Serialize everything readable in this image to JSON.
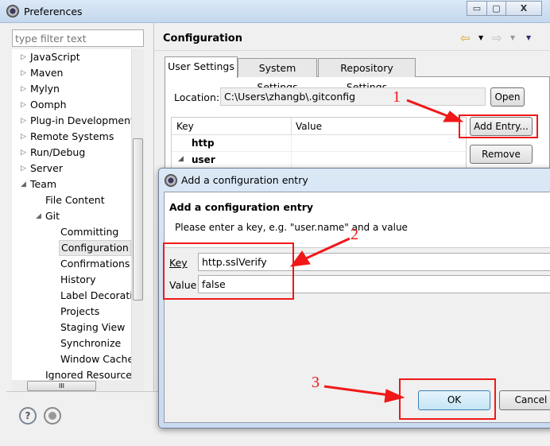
{
  "window": {
    "title": "Preferences",
    "controls": {
      "minimize": "▭",
      "maximize": "▢",
      "close": "X"
    }
  },
  "sidebar": {
    "filter_placeholder": "type filter text",
    "items": [
      {
        "label": "JavaScript",
        "level": 0,
        "state": "collapsed"
      },
      {
        "label": "Maven",
        "level": 0,
        "state": "collapsed"
      },
      {
        "label": "Mylyn",
        "level": 0,
        "state": "collapsed"
      },
      {
        "label": "Oomph",
        "level": 0,
        "state": "collapsed"
      },
      {
        "label": "Plug-in Development",
        "level": 0,
        "state": "collapsed"
      },
      {
        "label": "Remote Systems",
        "level": 0,
        "state": "collapsed"
      },
      {
        "label": "Run/Debug",
        "level": 0,
        "state": "collapsed"
      },
      {
        "label": "Server",
        "level": 0,
        "state": "collapsed"
      },
      {
        "label": "Team",
        "level": 0,
        "state": "expanded"
      },
      {
        "label": "File Content",
        "level": 1,
        "state": "leaf"
      },
      {
        "label": "Git",
        "level": 1,
        "state": "expanded"
      },
      {
        "label": "Committing",
        "level": 2,
        "state": "leaf"
      },
      {
        "label": "Configuration",
        "level": 2,
        "state": "leaf",
        "selected": true
      },
      {
        "label": "Confirmations a",
        "level": 2,
        "state": "leaf"
      },
      {
        "label": "History",
        "level": 2,
        "state": "leaf"
      },
      {
        "label": "Label Decoratio",
        "level": 2,
        "state": "leaf"
      },
      {
        "label": "Projects",
        "level": 2,
        "state": "leaf"
      },
      {
        "label": "Staging View",
        "level": 2,
        "state": "leaf"
      },
      {
        "label": "Synchronize",
        "level": 2,
        "state": "leaf"
      },
      {
        "label": "Window Cache",
        "level": 2,
        "state": "leaf"
      },
      {
        "label": "Ignored Resource",
        "level": 1,
        "state": "leaf"
      }
    ],
    "hscroll_grip": "III"
  },
  "main": {
    "title": "Configuration",
    "tabs": [
      {
        "label": "User Settings",
        "active": true
      },
      {
        "label": "System Settings"
      },
      {
        "label": "Repository Settings"
      }
    ],
    "location_label": "Location:",
    "location_value": "C:\\Users\\zhangb\\.gitconfig",
    "open_button": "Open",
    "table": {
      "columns": [
        "Key",
        "Value"
      ],
      "rows": [
        {
          "key": "http",
          "value": "",
          "expanded": false
        },
        {
          "key": "user",
          "value": "",
          "expanded": true
        }
      ]
    },
    "add_entry_button": "Add Entry...",
    "remove_button": "Remove"
  },
  "dialog": {
    "title": "Add a configuration entry",
    "header": "Add a configuration entry",
    "description": "Please enter a key, e.g. \"user.name\" and a value",
    "key_label": "Key",
    "key_value": "http.sslVerify",
    "value_label": "Value",
    "value_value": "false",
    "ok_button": "OK",
    "cancel_button": "Cancel"
  },
  "annotations": {
    "step1": "1",
    "step2": "2",
    "step3": "3",
    "color": "#f01818"
  }
}
